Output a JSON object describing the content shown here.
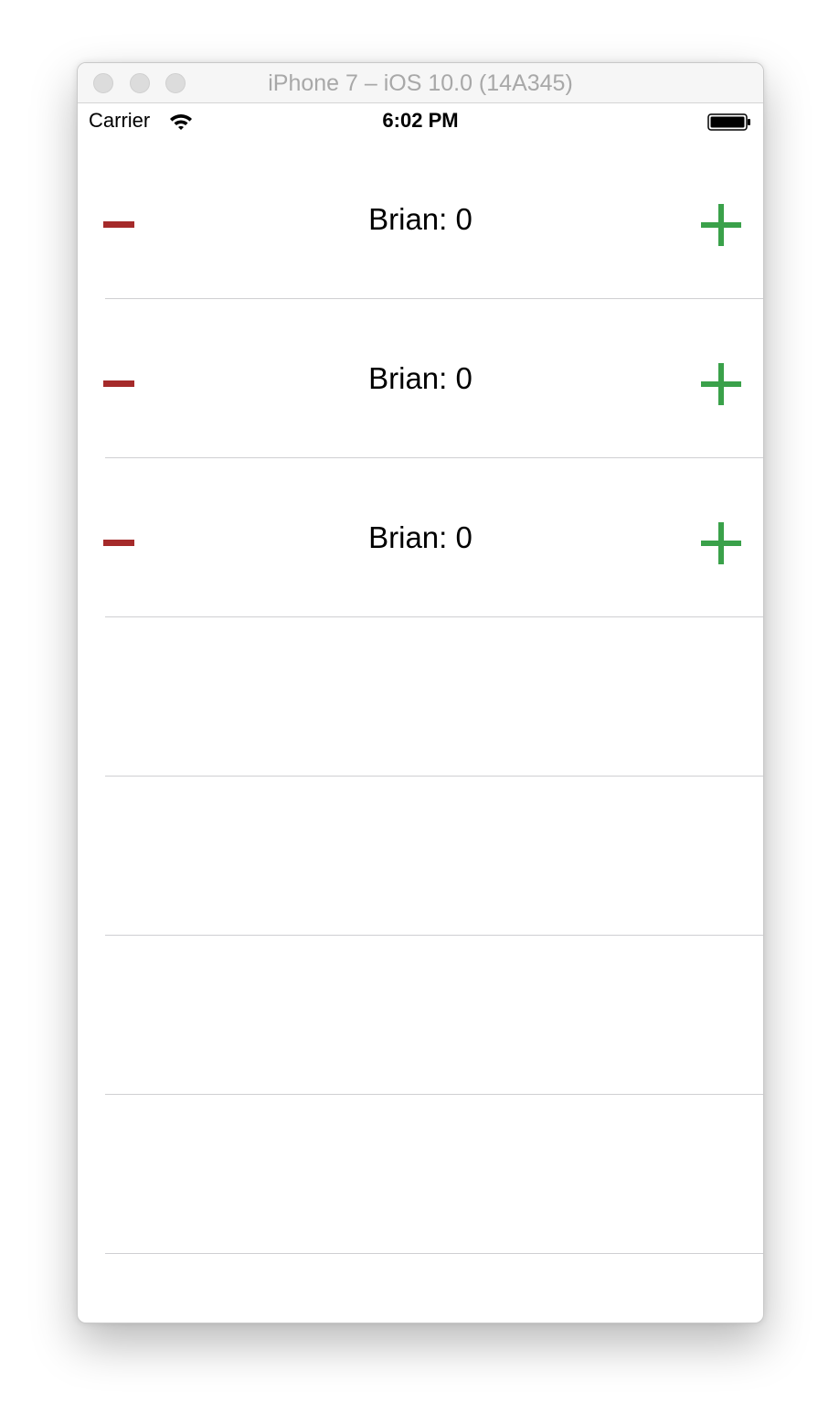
{
  "window": {
    "title": "iPhone 7 – iOS 10.0 (14A345)"
  },
  "status_bar": {
    "carrier": "Carrier",
    "time": "6:02 PM",
    "wifi_icon": "wifi-icon",
    "battery_icon": "battery-icon"
  },
  "players": [
    {
      "label": "Brian: 0",
      "name": "Brian",
      "score": 0
    },
    {
      "label": "Brian: 0",
      "name": "Brian",
      "score": 0
    },
    {
      "label": "Brian: 0",
      "name": "Brian",
      "score": 0
    }
  ],
  "controls": {
    "decrement_icon": "minus-icon",
    "increment_icon": "plus-icon"
  },
  "colors": {
    "decrement": "#a52a2a",
    "increment": "#3aa14a",
    "separator": "#cfcfd2",
    "title_text": "#a8a8a8"
  }
}
